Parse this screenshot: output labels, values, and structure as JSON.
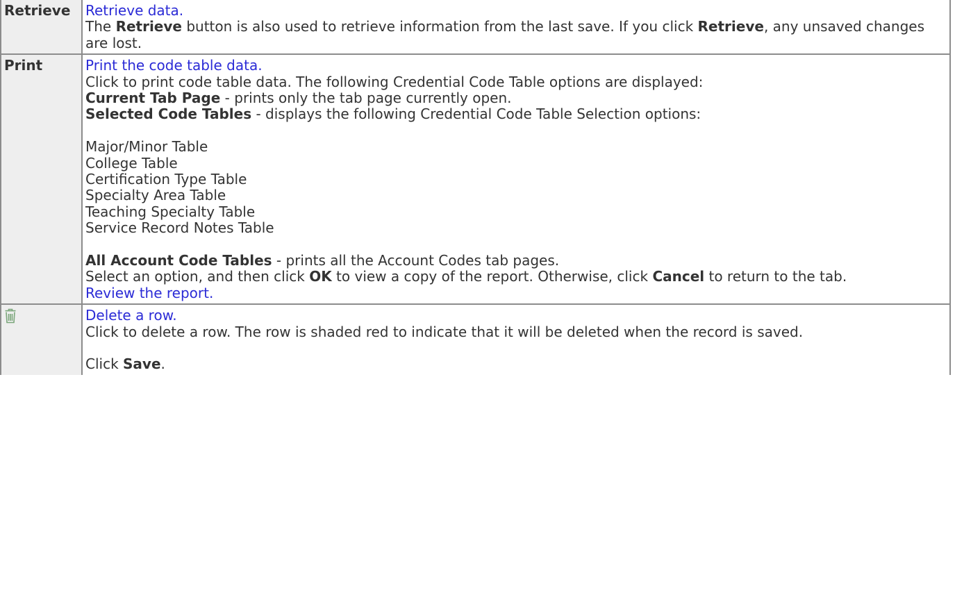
{
  "retrieve": {
    "name": "Retrieve",
    "link": "Retrieve data.",
    "desc": {
      "t1": "The ",
      "b1": "Retrieve",
      "t2": " button is also used to retrieve information from the last save. If you click ",
      "b2": "Retrieve",
      "t3": ", any unsaved changes are lost."
    }
  },
  "print": {
    "name": "Print",
    "link": "Print the code table data.",
    "intro": "Click to print code table data. The following Credential Code Table options are displayed:",
    "opt1": {
      "label": "Current Tab Page",
      "text": " - prints only the tab page currently open."
    },
    "opt2": {
      "label": "Selected Code Tables",
      "text": " - displays the following Credential Code Table Selection options:"
    },
    "tables": [
      "Major/Minor Table",
      "College Table",
      "Certification Type Table",
      "Specialty Area Table",
      "Teaching Specialty Table",
      "Service Record Notes Table"
    ],
    "opt3": {
      "label": "All Account Code Tables",
      "text": " - prints all the Account Codes tab pages."
    },
    "select": {
      "t1": "Select an option, and then click ",
      "ok": "OK",
      "t2": " to view a copy of the report. Otherwise, click ",
      "cancel": "Cancel",
      "t3": " to return to the tab."
    },
    "review_link": "Review the report."
  },
  "delete": {
    "icon": "trash-icon",
    "link": "Delete a row.",
    "desc": "Click to delete a row. The row is shaded red to indicate that it will be deleted when the record is saved.",
    "save": {
      "t1": "Click ",
      "b": "Save",
      "t2": "."
    }
  },
  "colors": {
    "link": "#2b2bd6",
    "border": "#8c8c8c",
    "label_bg": "#eeeeee",
    "icon": "#7aa67a"
  }
}
